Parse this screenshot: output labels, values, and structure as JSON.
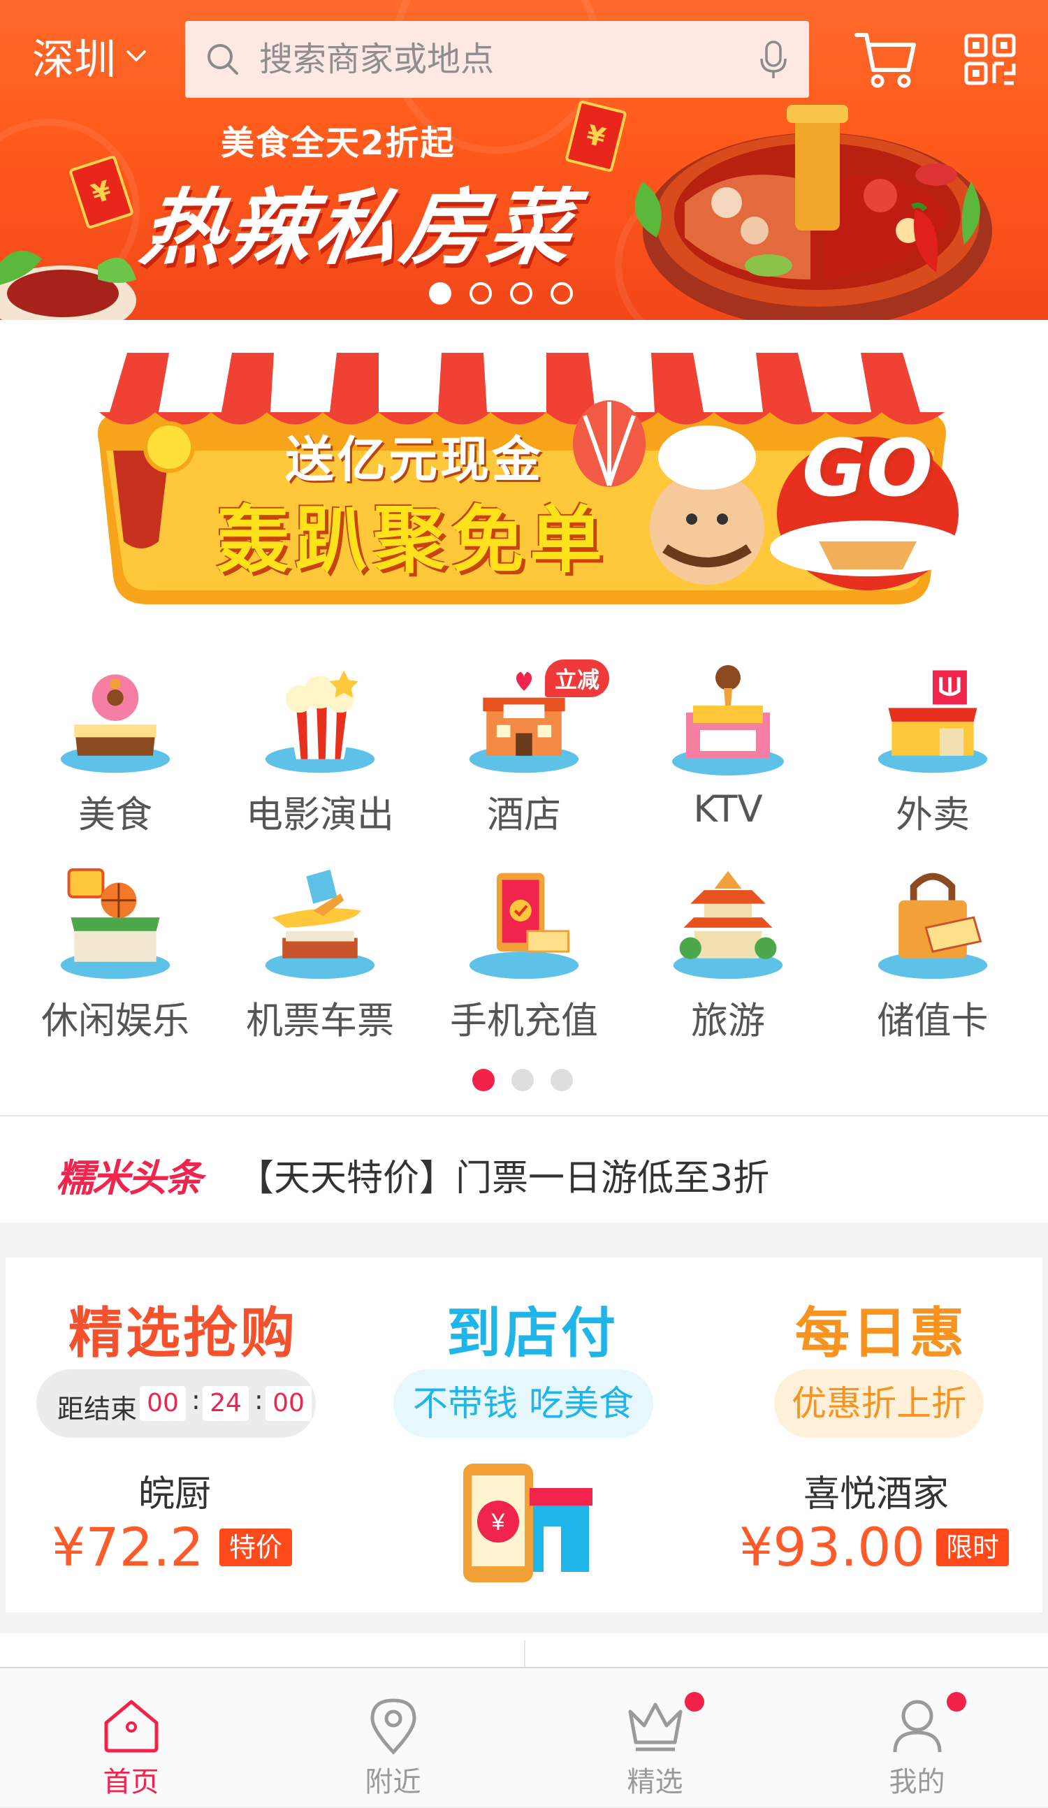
{
  "header": {
    "city": "深圳",
    "search_placeholder": "搜索商家或地点",
    "icons": {
      "city": "chevron-down-icon",
      "search": "search-icon",
      "mic": "microphone-icon",
      "cart": "cart-icon",
      "scan": "qr-code-icon"
    }
  },
  "banner": {
    "subtitle": "美食全天2折起",
    "title": "热辣私房菜",
    "page_count": 4,
    "active_page": 1
  },
  "ad": {
    "line1": "送亿元现金",
    "line2": "轰趴聚免单",
    "go": "GO"
  },
  "categories": [
    {
      "label": "美食",
      "icon": "cake-icon"
    },
    {
      "label": "电影演出",
      "icon": "popcorn-icon"
    },
    {
      "label": "酒店",
      "icon": "hotel-icon",
      "badge": "立减"
    },
    {
      "label": "KTV",
      "icon": "ktv-icon"
    },
    {
      "label": "外卖",
      "icon": "takeout-shop-icon"
    },
    {
      "label": "休闲娱乐",
      "icon": "sport-building-icon"
    },
    {
      "label": "机票车票",
      "icon": "airplane-ticket-icon"
    },
    {
      "label": "手机充值",
      "icon": "phone-recharge-icon"
    },
    {
      "label": "旅游",
      "icon": "pagoda-icon"
    },
    {
      "label": "储值卡",
      "icon": "vip-card-icon"
    }
  ],
  "category_pages": {
    "count": 3,
    "active": 1
  },
  "headline": {
    "logo": "糯米头条",
    "text": "【天天特价】门票一日游低至3折"
  },
  "deals": {
    "flash": {
      "title": "精选抢购",
      "timer_label": "距结束",
      "hours": "00",
      "minutes": "24",
      "seconds": "00",
      "shop": "皖厨",
      "price": "¥72.2",
      "tag": "特价"
    },
    "instore": {
      "title": "到店付",
      "pill": "不带钱 吃美食",
      "icon": "phone-store-icon"
    },
    "daily": {
      "title": "每日惠",
      "pill": "优惠折上折",
      "shop": "喜悦酒家",
      "price": "¥93.00",
      "tag": "限时"
    },
    "colors": {
      "flash": "#f4512c",
      "instore": "#1fb5e8",
      "daily": "#f7931e"
    }
  },
  "tabbar": {
    "tabs": [
      {
        "label": "首页",
        "icon": "home-icon",
        "active": true
      },
      {
        "label": "附近",
        "icon": "location-pin-icon",
        "active": false
      },
      {
        "label": "精选",
        "icon": "crown-icon",
        "active": false,
        "dot": true
      },
      {
        "label": "我的",
        "icon": "user-icon",
        "active": false,
        "dot": true
      }
    ],
    "accent": "#f2224b"
  }
}
